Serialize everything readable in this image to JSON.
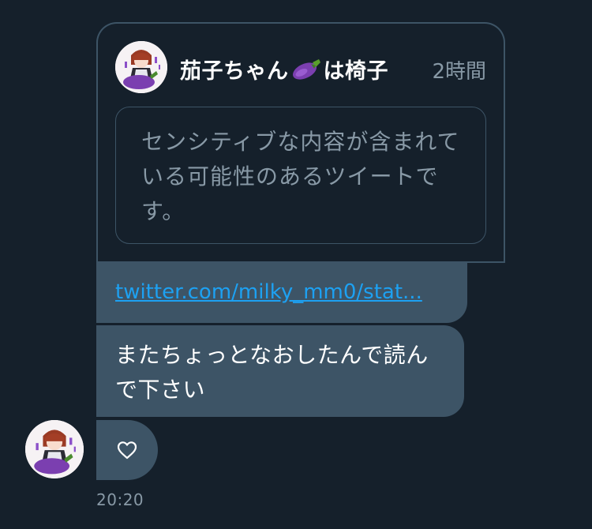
{
  "quote": {
    "author_name_part1": "茄子ちゃん",
    "author_name_part2": "は椅子",
    "author_emoji": "eggplant-emoji",
    "time": "2時間",
    "sensitive_notice": "センシティブな内容が含まれている可能性のあるツイートです。"
  },
  "messages": {
    "link": "twitter.com/milky_mm0/stat...",
    "text": "またちょっとなおしたんで読んで下さい",
    "like_icon": "heart-icon"
  },
  "meta": {
    "timestamp": "20:20"
  },
  "colors": {
    "background": "#15202b",
    "bubble": "#3d5466",
    "link": "#1da1f2",
    "muted": "#8899a6",
    "accent_purple": "#7b3fb0"
  }
}
